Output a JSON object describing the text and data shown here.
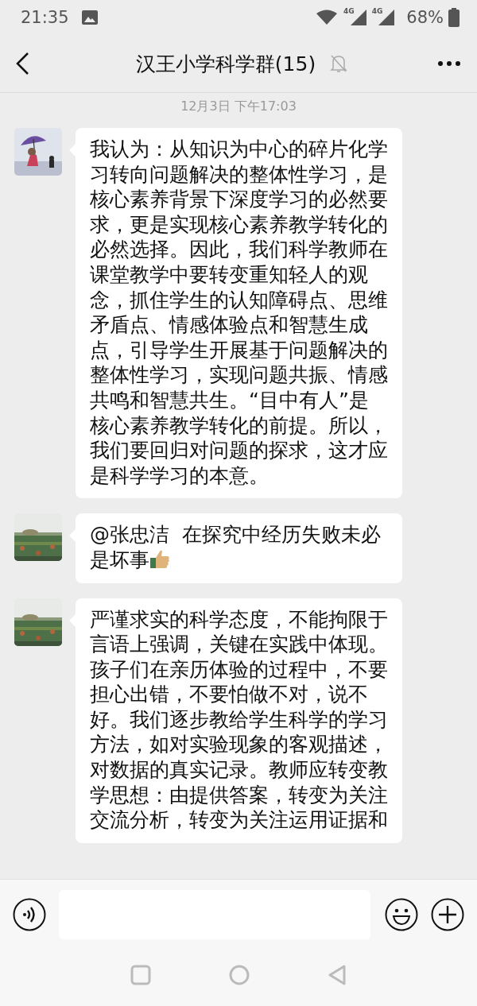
{
  "status_bar": {
    "time": "21:35",
    "network_labels": [
      "4G",
      "4G"
    ],
    "battery": "68%"
  },
  "header": {
    "title": "汉王小学科学群(15)",
    "muted": true
  },
  "timestamp": "12月3日 下午17:03",
  "messages": [
    {
      "kind": "text",
      "text": "我认为：从知识为中心的碎片化学习转向问题解决的整体性学习，是核心素养背景下深度学习的必然要求，更是实现核心素养教学转化的必然选择。因此，我们科学教师在课堂教学中要转变重知轻人的观念，抓住学生的认知障碍点、思维矛盾点、情感体验点和智慧生成点，引导学生开展基于问题解决的整体性学习，实现问题共振、情感共鸣和智慧共生。“目中有人”是核心素养教学转化的前提。所以，我们要回归对问题的探求，这才应是科学学习的本意。"
    },
    {
      "kind": "text_thumbs_up",
      "text": "@张忠洁  在探究中经历失败未必是坏事"
    },
    {
      "kind": "text",
      "text": "严谨求实的科学态度，不能拘限于言语上强调，关键在实践中体现。孩子们在亲历体验的过程中，不要担心出错，不要怕做不对，说不好。我们逐步教给学生科学的学习方法，如对实验现象的客观描述，对数据的真实记录。教师应转变教学思想：由提供答案，转变为关注交流分析，转变为关注运用证据和"
    }
  ]
}
